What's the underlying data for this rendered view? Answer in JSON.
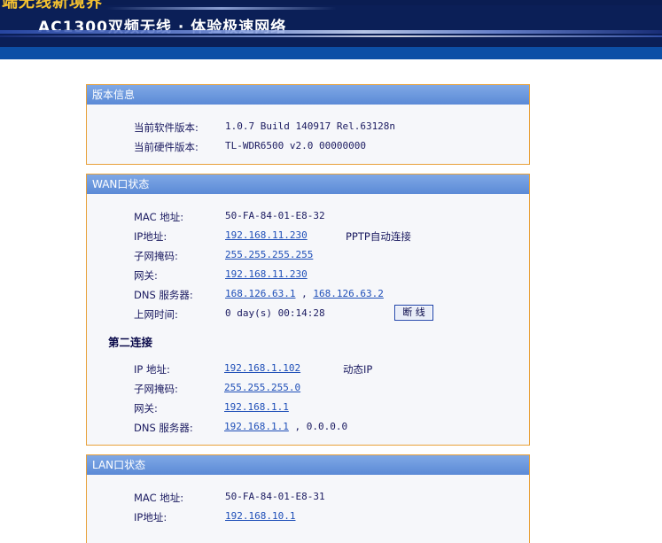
{
  "banner": {
    "slogan_top": "端无线新境界",
    "slogan": "AC1300双频无线 · 体验极速网络"
  },
  "version_panel": {
    "title": "版本信息",
    "software_label": "当前软件版本:",
    "software_value": "1.0.7 Build 140917 Rel.63128n",
    "hardware_label": "当前硬件版本:",
    "hardware_value": "TL-WDR6500 v2.0 00000000"
  },
  "wan_panel": {
    "title": "WAN口状态",
    "mac_label": "MAC 地址:",
    "mac_value": "50-FA-84-01-E8-32",
    "ip_label": "IP地址:",
    "ip_value": "192.168.11.230",
    "ip_mode": "PPTP自动连接",
    "mask_label": "子网掩码:",
    "mask_value": "255.255.255.255",
    "gateway_label": "网关:",
    "gateway_value": "192.168.11.230",
    "dns_label": "DNS 服务器:",
    "dns_value1": "168.126.63.1",
    "dns_sep": " , ",
    "dns_value2": "168.126.63.2",
    "uptime_label": "上网时间:",
    "uptime_value": "0 day(s) 00:14:28",
    "disconnect_label": "断 线",
    "second_title": "第二连接",
    "ip2_label": "IP 地址:",
    "ip2_value": "192.168.1.102",
    "ip2_mode": "动态IP",
    "mask2_label": "子网掩码:",
    "mask2_value": "255.255.255.0",
    "gateway2_label": "网关:",
    "gateway2_value": "192.168.1.1",
    "dns2_label": "DNS 服务器:",
    "dns2_value1": "192.168.1.1",
    "dns2_sep": " , ",
    "dns2_value2": "0.0.0.0"
  },
  "lan_panel": {
    "title": "LAN口状态",
    "mac_label": "MAC 地址:",
    "mac_value": "50-FA-84-01-E8-31",
    "ip_label": "IP地址:",
    "ip_value": "192.168.10.1"
  }
}
